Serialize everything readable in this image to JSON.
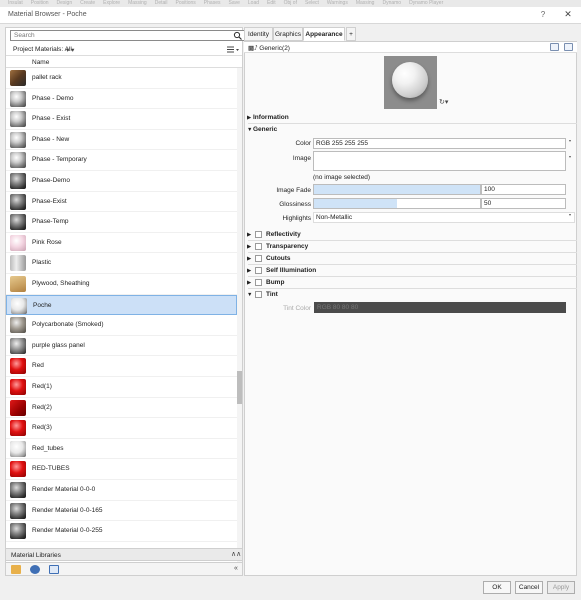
{
  "ribbon": [
    "Insulat",
    "Position",
    "Design",
    "Create",
    "Explore",
    "Massing",
    "Detail",
    "Positions",
    "Phases",
    "Save",
    "Load",
    "Edit",
    "Obj of",
    "Select",
    "Warnings",
    "Massing",
    "Dynamo",
    "Dynamo Player"
  ],
  "window": {
    "title": "Material Browser - Poche",
    "help": "?",
    "close": "✕"
  },
  "search": {
    "placeholder": "Search",
    "icon": "search-icon"
  },
  "project": {
    "label": "Project Materials: All",
    "filter": "▾ ▾",
    "view_icon": "list-view-icon"
  },
  "list_header": "Name",
  "materials": [
    {
      "name": "pallet rack",
      "swatch": "rack"
    },
    {
      "name": "Phase - Demo",
      "swatch": "sphere-grey"
    },
    {
      "name": "Phase - Exist",
      "swatch": "sphere-grey"
    },
    {
      "name": "Phase - New",
      "swatch": "sphere-grey"
    },
    {
      "name": "Phase - Temporary",
      "swatch": "sphere-grey"
    },
    {
      "name": "Phase-Demo",
      "swatch": "sphere-dark"
    },
    {
      "name": "Phase-Exist",
      "swatch": "sphere-dark"
    },
    {
      "name": "Phase-Temp",
      "swatch": "sphere-dark"
    },
    {
      "name": "Pink Rose",
      "swatch": "sphere-pink"
    },
    {
      "name": "Plastic",
      "swatch": "plastic"
    },
    {
      "name": "Plywood, Sheathing",
      "swatch": "plywood"
    },
    {
      "name": "Poche",
      "swatch": "sphere-light",
      "selected": true
    },
    {
      "name": "Polycarbonate (Smoked)",
      "swatch": "poly"
    },
    {
      "name": "purple glass panel",
      "swatch": "purple"
    },
    {
      "name": "Red",
      "swatch": "sphere-red"
    },
    {
      "name": "Red(1)",
      "swatch": "sphere-red"
    },
    {
      "name": "Red(2)",
      "swatch": "redflat"
    },
    {
      "name": "Red(3)",
      "swatch": "sphere-red"
    },
    {
      "name": "Red_tubes",
      "swatch": "sphere-light"
    },
    {
      "name": "RED-TUBES",
      "swatch": "sphere-red"
    },
    {
      "name": "Render Material 0-0-0",
      "swatch": "sphere-dark"
    },
    {
      "name": "Render Material 0-0-165",
      "swatch": "sphere-dark"
    },
    {
      "name": "Render Material 0-0-255",
      "swatch": "sphere-dark"
    }
  ],
  "libraries": {
    "label": "Material Libraries",
    "collapse": "∧∧",
    "collapse_left": "«"
  },
  "tabs": [
    "Identity",
    "Graphics",
    "Appearance",
    "+"
  ],
  "asset": {
    "name": "Generic(2)"
  },
  "sections": {
    "information": "Information",
    "generic": "Generic",
    "reflectivity": "Reflectivity",
    "transparency": "Transparency",
    "cutouts": "Cutouts",
    "self_illumination": "Self Illumination",
    "bump": "Bump",
    "tint": "Tint"
  },
  "generic": {
    "color_label": "Color",
    "color_value": "RGB 255 255 255",
    "image_label": "Image",
    "no_image": "(no image selected)",
    "image_fade_label": "Image Fade",
    "image_fade_value": "100",
    "image_fade_fraction": 1.0,
    "glossiness_label": "Glossiness",
    "glossiness_value": "50",
    "glossiness_fraction": 0.5,
    "highlights_label": "Highlights",
    "highlights_value": "Non-Metallic"
  },
  "tint": {
    "label": "Tint Color",
    "value": "RGB 80 80 80"
  },
  "buttons": {
    "ok": "OK",
    "cancel": "Cancel",
    "apply": "Apply"
  }
}
